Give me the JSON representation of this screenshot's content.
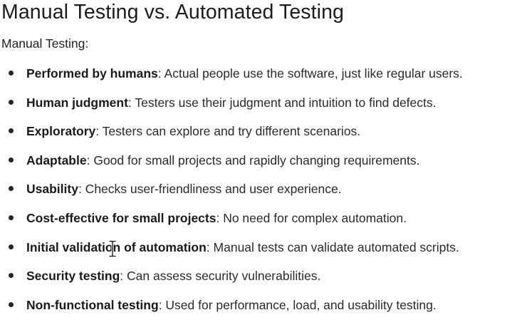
{
  "document": {
    "title": "Manual Testing vs. Automated Testing",
    "subtitle": "Manual Testing:",
    "items": [
      {
        "term": "Performed by humans",
        "description": ": Actual people use the software, just like regular users."
      },
      {
        "term": "Human judgment",
        "description": ": Testers use their judgment and intuition to find defects."
      },
      {
        "term": "Exploratory",
        "description": ": Testers can explore and try different scenarios."
      },
      {
        "term": "Adaptable",
        "description": ": Good for small projects and rapidly changing requirements."
      },
      {
        "term": "Usability",
        "description": ": Checks user-friendliness and user experience."
      },
      {
        "term": "Cost-effective for small projects",
        "description": ": No need for complex automation."
      },
      {
        "term": "Initial validation of automation",
        "description": ": Manual tests can validate automated scripts."
      },
      {
        "term": "Security testing",
        "description": ": Can assess security vulnerabilities."
      },
      {
        "term": "Non-functional testing",
        "description": ": Used for performance, load, and usability testing."
      }
    ]
  },
  "icons": {
    "cursor": "text-cursor-icon",
    "bullet": "bullet-dot-icon"
  }
}
